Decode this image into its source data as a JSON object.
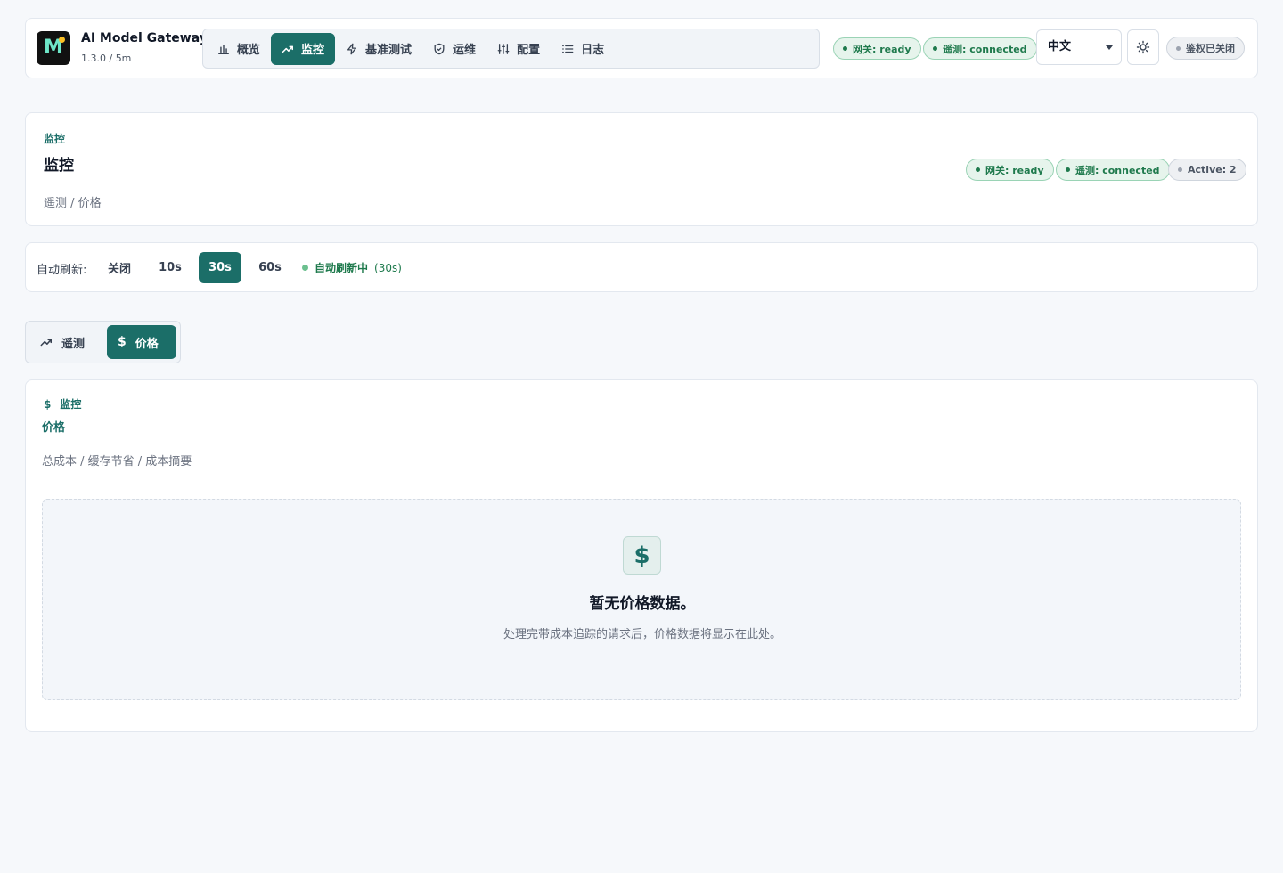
{
  "header": {
    "logo_letter": "M",
    "app_title": "AI Model Gateway",
    "app_version": "1.3.0 / 5m",
    "nav": [
      {
        "label": "概览",
        "icon": "bar-chart-icon"
      },
      {
        "label": "监控",
        "icon": "trending-up-icon",
        "active": true
      },
      {
        "label": "基准测试",
        "icon": "zap-icon"
      },
      {
        "label": "运维",
        "icon": "shield-icon"
      },
      {
        "label": "配置",
        "icon": "sliders-icon"
      },
      {
        "label": "日志",
        "icon": "list-icon"
      }
    ],
    "status_gateway": "网关: ready",
    "status_telemetry": "遥测: connected",
    "language": "中文",
    "auth_status": "鉴权已关闭"
  },
  "page": {
    "eyebrow": "监控",
    "title": "监控",
    "subtitle": "遥测 / 价格",
    "status_gateway": "网关: ready",
    "status_telemetry": "遥测: connected",
    "status_active": "Active: 2"
  },
  "refresh": {
    "label": "自动刷新:",
    "options": [
      "关闭",
      "10s",
      "30s",
      "60s"
    ],
    "selected": "30s",
    "status": "自动刷新中",
    "status_interval": "(30s)"
  },
  "subtabs": [
    {
      "label": "遥测",
      "icon": "trending-up-icon"
    },
    {
      "label": "价格",
      "icon": "dollar-icon",
      "active": true
    }
  ],
  "price": {
    "eyebrow": "监控",
    "title": "价格",
    "subtitle": "总成本 / 缓存节省 / 成本摘要",
    "empty_icon": "$",
    "empty_title": "暂无价格数据。",
    "empty_desc": "处理完带成本追踪的请求后，价格数据将显示在此处。"
  },
  "colors": {
    "accent": "#1b6e68",
    "success": "#1f7a4d",
    "background": "#f6f8fb"
  }
}
